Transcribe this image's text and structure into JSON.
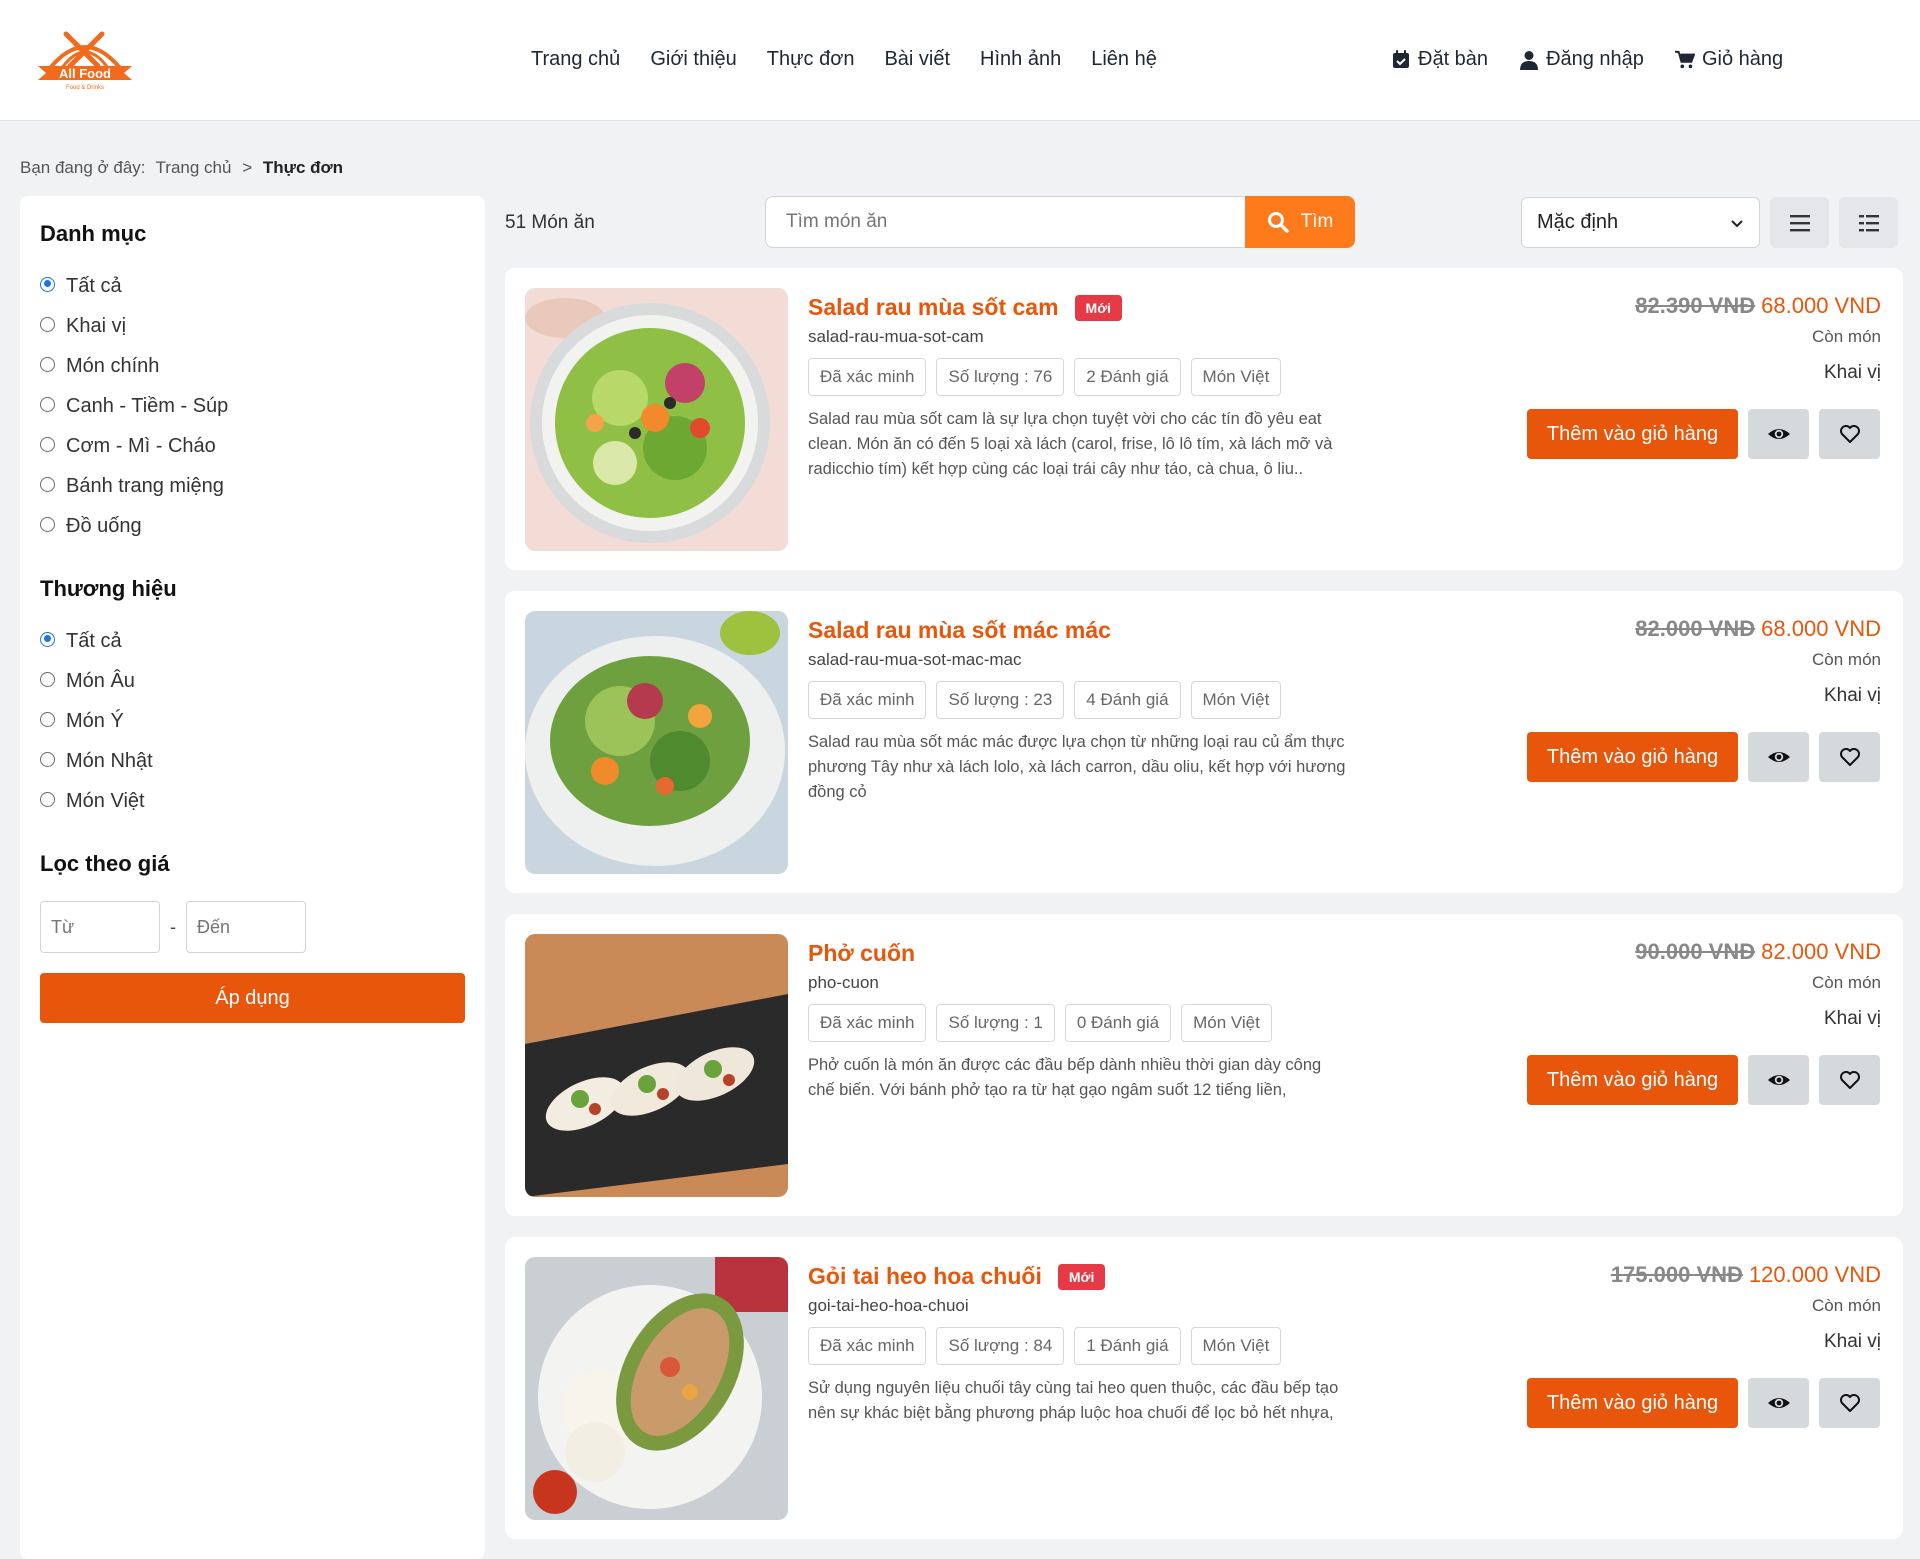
{
  "brand": {
    "name": "All Food",
    "tagline": "Food & Drinks",
    "accent": "#e8560c"
  },
  "nav": [
    "Trang chủ",
    "Giới thiệu",
    "Thực đơn",
    "Bài viết",
    "Hình ảnh",
    "Liên hệ"
  ],
  "header_actions": {
    "book": "Đặt bàn",
    "login": "Đăng nhập",
    "cart": "Giỏ hàng"
  },
  "breadcrumb": {
    "prefix": "Bạn đang ở đây:",
    "home": "Trang chủ",
    "separator": ">",
    "current": "Thực đơn"
  },
  "sidebar": {
    "category_title": "Danh mục",
    "categories": [
      "Tất cả",
      "Khai vị",
      "Món chính",
      "Canh - Tiềm - Súp",
      "Cơm - Mì - Cháo",
      "Bánh trang miệng",
      "Đồ uống"
    ],
    "brand_title": "Thương hiệu",
    "brands": [
      "Tất cả",
      "Món Âu",
      "Món Ý",
      "Món Nhật",
      "Món Việt"
    ],
    "price_title": "Lọc theo giá",
    "price_from_placeholder": "Từ",
    "price_dash": "-",
    "price_to_placeholder": "Đến",
    "apply_label": "Áp dụng"
  },
  "toolbar": {
    "count": "51 Món ăn",
    "search_placeholder": "Tìm món ăn",
    "search_button": "Tìm",
    "sort_value": "Mặc định"
  },
  "products": [
    {
      "name": "Salad rau mùa sốt cam",
      "badge": "Mới",
      "slug": "salad-rau-mua-sot-cam",
      "tags": [
        "Đã xác minh",
        "Số lượng : 76",
        "2 Đánh giá",
        "Món Việt"
      ],
      "description": "Salad rau mùa sốt cam là sự lựa chọn tuyệt vời cho các tín đồ yêu eat clean. Món ăn có đến 5 loại xà lách (carol, frise, lô lô tím, xà lách mỡ và radicchio tím) kết hợp cùng các loại trái cây như táo, cà chua, ô liu..",
      "old_price": "82.390 VNĐ",
      "new_price": "68.000 VND",
      "stock": "Còn món",
      "category": "Khai vị",
      "add_label": "Thêm vào giỏ hàng"
    },
    {
      "name": "Salad rau mùa sốt mác mác",
      "badge": "",
      "slug": "salad-rau-mua-sot-mac-mac",
      "tags": [
        "Đã xác minh",
        "Số lượng : 23",
        "4 Đánh giá",
        "Món Việt"
      ],
      "description": "Salad rau mùa sốt mác mác được lựa chọn từ những loại rau củ ẩm thực phương Tây như xà lách lolo, xà lách carron, dầu oliu, kết hợp với hương đồng cỏ",
      "old_price": "82.000 VNĐ",
      "new_price": "68.000 VND",
      "stock": "Còn món",
      "category": "Khai vị",
      "add_label": "Thêm vào giỏ hàng"
    },
    {
      "name": "Phở cuốn",
      "badge": "",
      "slug": "pho-cuon",
      "tags": [
        "Đã xác minh",
        "Số lượng : 1",
        "0 Đánh giá",
        "Món Việt"
      ],
      "description": "Phở cuốn là món ăn được các đầu bếp dành nhiều thời gian dày công chế biến. Với bánh phở tạo ra từ hạt gạo ngâm suốt 12 tiếng liền,",
      "old_price": "90.000 VNĐ",
      "new_price": "82.000 VND",
      "stock": "Còn món",
      "category": "Khai vị",
      "add_label": "Thêm vào giỏ hàng"
    },
    {
      "name": "Gỏi tai heo hoa chuối",
      "badge": "Mới",
      "slug": "goi-tai-heo-hoa-chuoi",
      "tags": [
        "Đã xác minh",
        "Số lượng : 84",
        "1 Đánh giá",
        "Món Việt"
      ],
      "description": "Sử dụng nguyên liệu chuối tây cùng tai heo quen thuộc, các đầu bếp tạo nên sự khác biệt bằng phương pháp luộc hoa chuối để lọc bỏ hết nhựa,",
      "old_price": "175.000 VNĐ",
      "new_price": "120.000 VND",
      "stock": "Còn món",
      "category": "Khai vị",
      "add_label": "Thêm vào giỏ hàng"
    }
  ]
}
